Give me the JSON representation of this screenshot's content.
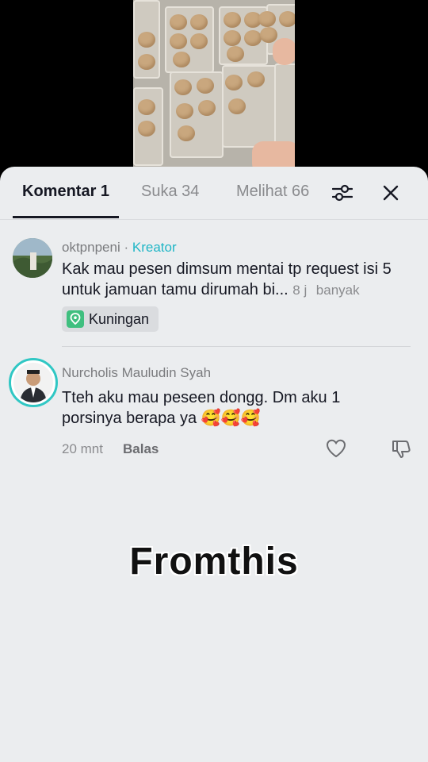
{
  "tabs": [
    {
      "label": "Komentar 1",
      "active": true
    },
    {
      "label": "Suka 34",
      "active": false
    },
    {
      "label": "Melihat 66",
      "active": false
    }
  ],
  "icons": {
    "filter": "sliders-icon",
    "close": "close-icon",
    "like": "heart-icon",
    "dislike": "thumbs-down-icon",
    "location": "location-pin-icon"
  },
  "comments": [
    {
      "username": "oktpnpeni",
      "separator": "·",
      "badge": "Kreator",
      "text": "Kak mau pesen dimsum mentai tp request isi 5 untuk jamuan tamu dirumah bi...",
      "time": "8 j",
      "more": "banyak",
      "location": "Kuningan"
    },
    {
      "username": "Nurcholis Mauludin Syah",
      "text": "Tteh aku mau peseen dongg. Dm aku 1 porsinya berapa ya 🥰🥰🥰",
      "time": "20 mnt",
      "reply": "Balas"
    }
  ],
  "overlay": {
    "caption": "Fromthis"
  },
  "colors": {
    "sheet_bg": "#ebedef",
    "creator": "#20b6c6",
    "active_tab": "#161823"
  }
}
